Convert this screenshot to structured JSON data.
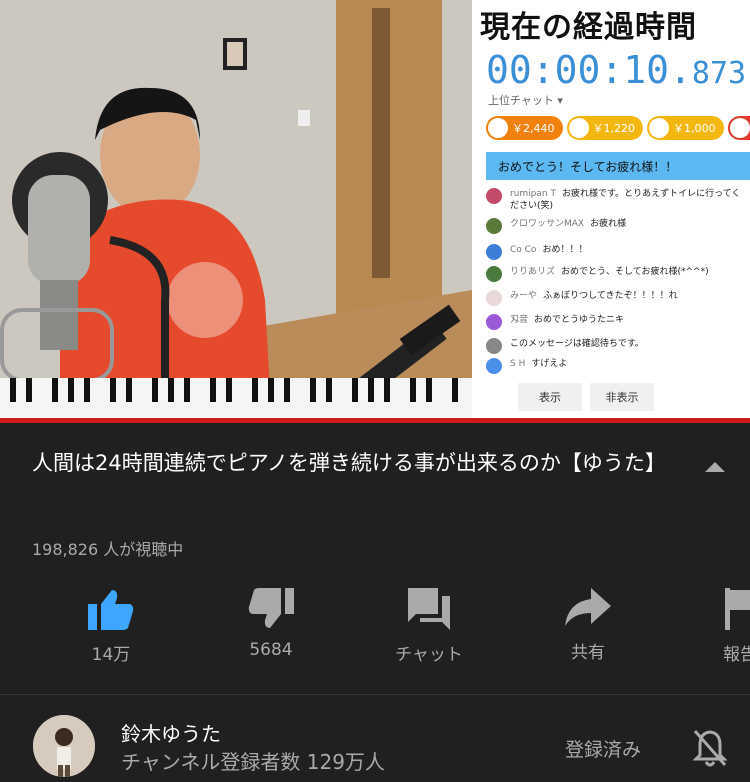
{
  "overlay": {
    "timer_title": "現在の経過時間",
    "timer_main": "00:00:10.",
    "timer_ms": "873",
    "chat_header": "上位チャット ▾",
    "superchats": [
      {
        "amount": "￥2,440",
        "color": "#f2820f"
      },
      {
        "amount": "￥1,220",
        "color": "#f2b811"
      },
      {
        "amount": "￥1,000",
        "color": "#f2b811"
      },
      {
        "amount": "￥",
        "color": "#e0392c"
      }
    ],
    "pinned": "おめでとう！そしてお疲れ様！！",
    "messages": [
      {
        "name": "rumipan T",
        "text": "お疲れ様です。とりあえずトイレに行ってください(笑)",
        "color": "#c44a6a"
      },
      {
        "name": "クロワッサンMAX",
        "text": "お疲れ様",
        "color": "#5a7a3a"
      },
      {
        "name": "Co Co",
        "text": "おめ！！！",
        "color": "#3d7fd8"
      },
      {
        "name": "りりあリズ",
        "text": "おめでとう、そしてお疲れ様(*^^*)",
        "color": "#4a7a3d"
      },
      {
        "name": "みーや",
        "text": "ふぁぼりつしてきたぞ！！！！れ",
        "color": "#e8d8d8"
      },
      {
        "name": "刄音",
        "text": "おめでとうゆうたニキ",
        "color": "#9a5ad8"
      },
      {
        "name": "",
        "text": "このメッセージは確認待ちです。",
        "color": "#888888"
      },
      {
        "name": "S H",
        "text": "すげえよ",
        "color": "#4a8fe8"
      }
    ],
    "show_button": "表示",
    "hide_button": "非表示"
  },
  "video": {
    "title": "人間は24時間連続でピアノを弾き続ける事が出来るのか【ゆうた】",
    "viewers": "198,826 人が視聴中"
  },
  "actions": {
    "like_count": "14万",
    "dislike_count": "5684",
    "chat_label": "チャット",
    "share_label": "共有",
    "report_label": "報告"
  },
  "channel": {
    "name": "鈴木ゆうた",
    "subscribers": "チャンネル登録者数 129万人",
    "subscribed_label": "登録済み"
  },
  "icons": {
    "like": "thumbs-up-icon",
    "dislike": "thumbs-down-icon",
    "chat": "chat-icon",
    "share": "share-icon",
    "report": "flag-icon",
    "bell": "bell-off-icon",
    "expand": "chevron-up-icon"
  },
  "colors": {
    "like_active": "#3ea6ff",
    "progress": "#cc1b1b",
    "timer": "#3a8fd6"
  }
}
